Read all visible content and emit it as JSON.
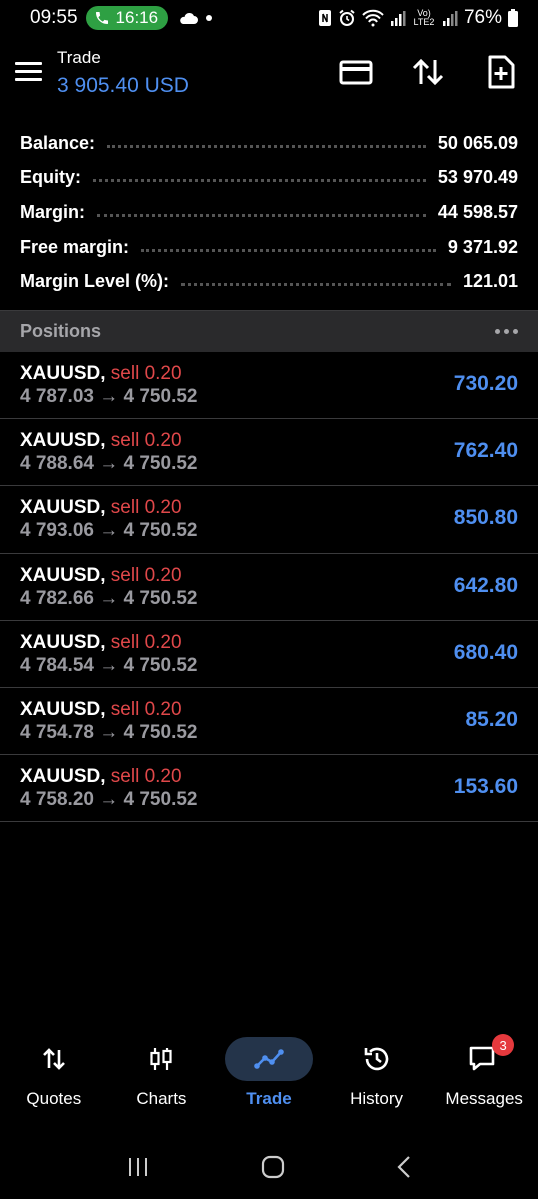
{
  "status_bar": {
    "time": "09:55",
    "call_time": "16:16",
    "network_label": "Vo) LTE2",
    "battery": "76%"
  },
  "header": {
    "title": "Trade",
    "total_profit": "3 905.40 USD"
  },
  "account": [
    {
      "label": "Balance:",
      "value": "50 065.09"
    },
    {
      "label": "Equity:",
      "value": "53 970.49"
    },
    {
      "label": "Margin:",
      "value": "44 598.57"
    },
    {
      "label": "Free margin:",
      "value": "9 371.92"
    },
    {
      "label": "Margin Level (%):",
      "value": "121.01"
    }
  ],
  "positions_header": "Positions",
  "positions": [
    {
      "symbol": "XAUUSD,",
      "type": "sell 0.20",
      "prices": "4 787.03 → 4 750.52",
      "profit": "730.20"
    },
    {
      "symbol": "XAUUSD,",
      "type": "sell 0.20",
      "prices": "4 788.64 → 4 750.52",
      "profit": "762.40"
    },
    {
      "symbol": "XAUUSD,",
      "type": "sell 0.20",
      "prices": "4 793.06 → 4 750.52",
      "profit": "850.80"
    },
    {
      "symbol": "XAUUSD,",
      "type": "sell 0.20",
      "prices": "4 782.66 → 4 750.52",
      "profit": "642.80"
    },
    {
      "symbol": "XAUUSD,",
      "type": "sell 0.20",
      "prices": "4 784.54 → 4 750.52",
      "profit": "680.40"
    },
    {
      "symbol": "XAUUSD,",
      "type": "sell 0.20",
      "prices": "4 754.78 → 4 750.52",
      "profit": "85.20"
    },
    {
      "symbol": "XAUUSD,",
      "type": "sell 0.20",
      "prices": "4 758.20 → 4 750.52",
      "profit": "153.60"
    }
  ],
  "nav": [
    {
      "label": "Quotes",
      "icon": "quotes-icon"
    },
    {
      "label": "Charts",
      "icon": "charts-icon"
    },
    {
      "label": "Trade",
      "icon": "trade-icon"
    },
    {
      "label": "History",
      "icon": "history-icon"
    },
    {
      "label": "Messages",
      "icon": "messages-icon",
      "badge": "3"
    }
  ],
  "colors": {
    "accent": "#4f8ff0",
    "sell": "#e0484a",
    "badge": "#e5393d",
    "call_pill": "#2ea043"
  }
}
